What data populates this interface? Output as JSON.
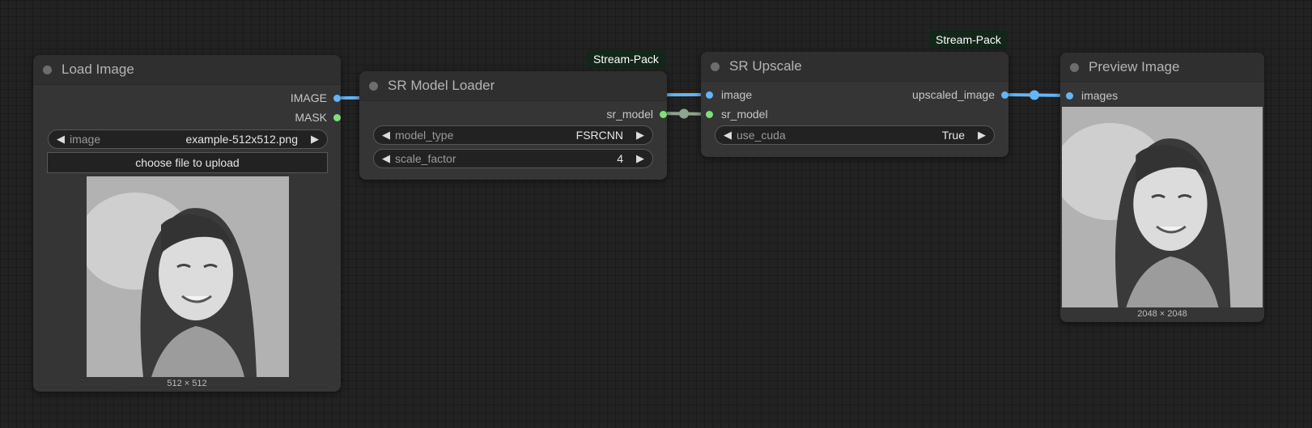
{
  "nodes": {
    "load_image": {
      "title": "Load Image",
      "outputs": [
        "IMAGE",
        "MASK"
      ],
      "image_widget": {
        "label": "image",
        "value": "example-512x512.png"
      },
      "upload_label": "choose file to upload",
      "image_size": "512 × 512"
    },
    "sr_model_loader": {
      "title": "SR Model Loader",
      "badge": "Stream-Pack",
      "output": "sr_model",
      "widgets": [
        {
          "label": "model_type",
          "value": "FSRCNN"
        },
        {
          "label": "scale_factor",
          "value": "4"
        }
      ]
    },
    "sr_upscale": {
      "title": "SR Upscale",
      "badge": "Stream-Pack",
      "inputs": [
        "image",
        "sr_model"
      ],
      "output": "upscaled_image",
      "widgets": [
        {
          "label": "use_cuda",
          "value": "True"
        }
      ]
    },
    "preview_image": {
      "title": "Preview Image",
      "input": "images",
      "image_size": "2048 × 2048"
    }
  },
  "colors": {
    "image_link": "#64b5f6",
    "model_link": "#8fa58d",
    "image_slot": "#64b5f6",
    "model_slot": "#7fe07a",
    "badge_bg": "#12261a"
  }
}
